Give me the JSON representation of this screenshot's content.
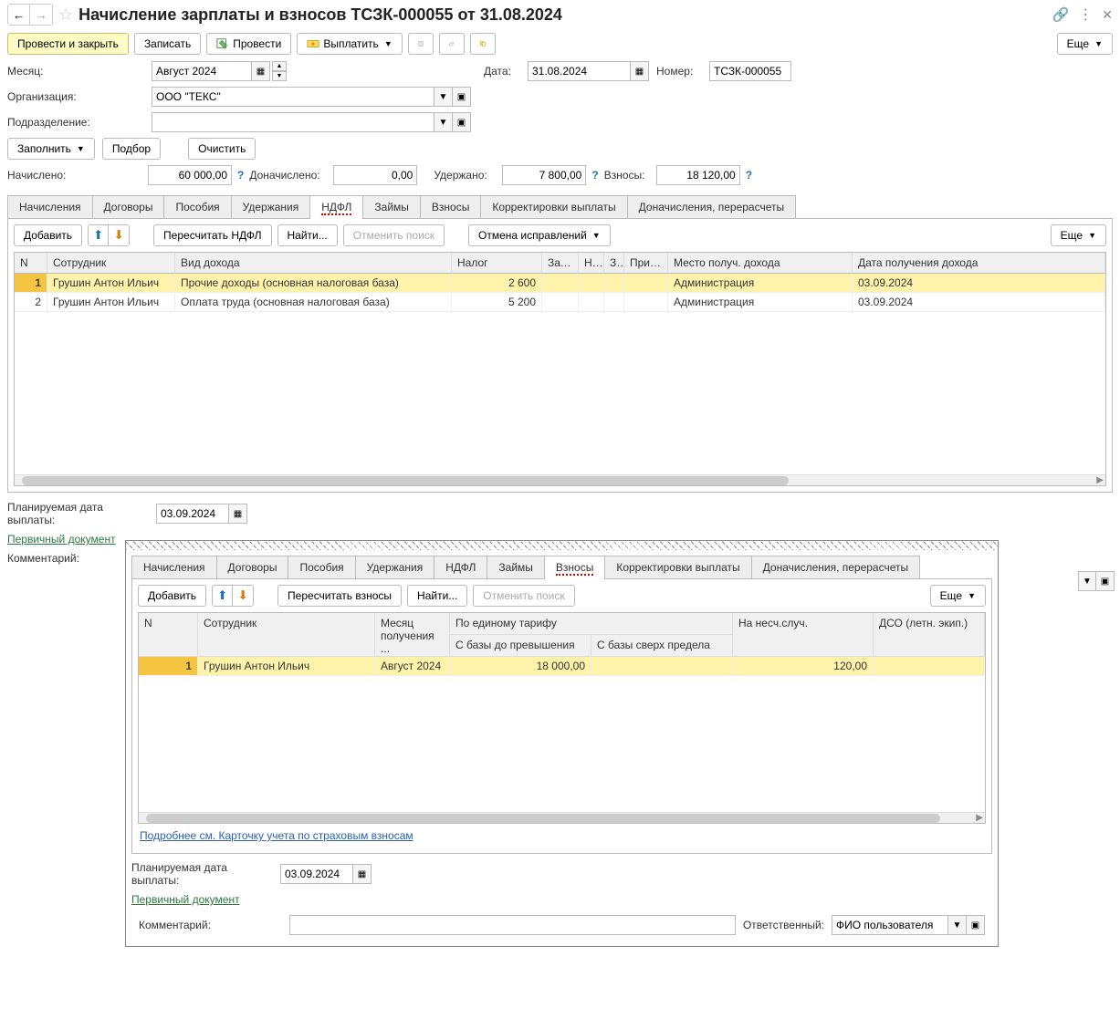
{
  "title": "Начисление зарплаты и взносов ТСЗК-000055 от 31.08.2024",
  "toolbar": {
    "post_close": "Провести и закрыть",
    "save": "Записать",
    "post": "Провести",
    "pay": "Выплатить",
    "more": "Еще"
  },
  "fields": {
    "month_label": "Месяц:",
    "month_value": "Август 2024",
    "date_label": "Дата:",
    "date_value": "31.08.2024",
    "number_label": "Номер:",
    "number_value": "ТСЗК-000055",
    "org_label": "Организация:",
    "org_value": "ООО \"ТЕКС\"",
    "dept_label": "Подразделение:",
    "dept_value": ""
  },
  "fill_btns": {
    "fill": "Заполнить",
    "select": "Подбор",
    "clear": "Очистить"
  },
  "totals": {
    "accrued_label": "Начислено:",
    "accrued_value": "60 000,00",
    "additional_label": "Доначислено:",
    "additional_value": "0,00",
    "withheld_label": "Удержано:",
    "withheld_value": "7 800,00",
    "contrib_label": "Взносы:",
    "contrib_value": "18 120,00"
  },
  "tabs1": [
    "Начисления",
    "Договоры",
    "Пособия",
    "Удержания",
    "НДФЛ",
    "Займы",
    "Взносы",
    "Корректировки выплаты",
    "Доначисления, перерасчеты"
  ],
  "tab1_toolbar": {
    "add": "Добавить",
    "recalc": "Пересчитать НДФЛ",
    "find": "Найти...",
    "cancel_search": "Отменить поиск",
    "cancel_fix": "Отмена исправлений",
    "more": "Еще"
  },
  "grid1": {
    "cols": [
      "N",
      "Сотрудник",
      "Вид дохода",
      "Налог",
      "Зач...",
      "Н...",
      "З.",
      "Прим...",
      "Место получ. дохода",
      "Дата получения дохода"
    ],
    "rows": [
      {
        "n": "1",
        "emp": "Грушин Антон Ильич",
        "kind": "Прочие доходы (основная налоговая база)",
        "tax": "2 600",
        "place": "Администрация",
        "date": "03.09.2024"
      },
      {
        "n": "2",
        "emp": "Грушин Антон Ильич",
        "kind": "Оплата труда (основная налоговая база)",
        "tax": "5 200",
        "place": "Администрация",
        "date": "03.09.2024"
      }
    ]
  },
  "plan_date_label": "Планируемая дата выплаты:",
  "plan_date_value": "03.09.2024",
  "primary_doc": "Первичный документ",
  "comment_label": "Комментарий:",
  "tabs2": [
    "Начисления",
    "Договоры",
    "Пособия",
    "Удержания",
    "НДФЛ",
    "Займы",
    "Взносы",
    "Корректировки выплаты",
    "Доначисления, перерасчеты"
  ],
  "tab2_toolbar": {
    "add": "Добавить",
    "recalc": "Пересчитать взносы",
    "find": "Найти...",
    "cancel_search": "Отменить поиск",
    "more": "Еще"
  },
  "grid2": {
    "h1": [
      "N",
      "Сотрудник",
      "Месяц",
      "По единому тарифу",
      "",
      "На несч.случ.",
      "ДСО (летн. экип.)"
    ],
    "h1_3_text": "Месяц получения ...",
    "h2_sbz": "С базы до превышения",
    "h2_sbsp": "С базы сверх предела",
    "rows": [
      {
        "n": "1",
        "emp": "Грушин Антон Ильич",
        "month": "Август 2024",
        "sbz": "18 000,00",
        "sbsp": "",
        "ns": "120,00",
        "dso": ""
      }
    ]
  },
  "card_link": "Подробнее см. Карточку учета по страховым взносам",
  "plan_date2_value": "03.09.2024",
  "resp_label": "Ответственный:",
  "resp_value": "ФИО пользователя"
}
